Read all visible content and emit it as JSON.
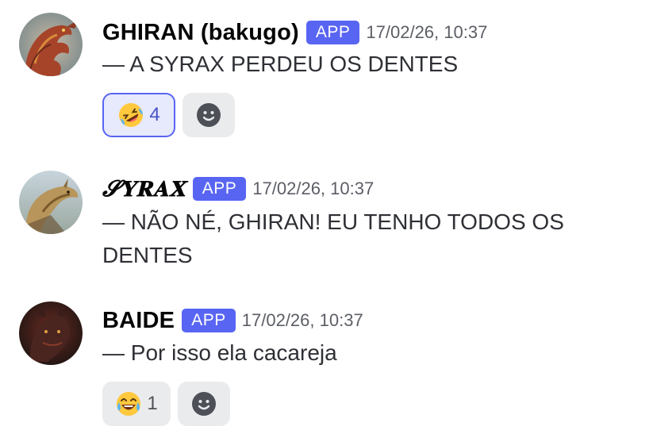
{
  "messages": [
    {
      "username": "GHIRAN (bakugo)",
      "badge": "APP",
      "timestamp": "17/02/26, 10:37",
      "content": "— A SYRAX PERDEU OS DENTES",
      "avatar_icon": "red-dragon-avatar",
      "reactions": [
        {
          "emoji": "rolling-on-floor-laughing",
          "count": "4",
          "active": true
        }
      ]
    },
    {
      "username": "𝓢𝐘𝐑𝐀𝐗",
      "badge": "APP",
      "timestamp": "17/02/26, 10:37",
      "content": "— NÃO NÉ, GHIRAN! EU TENHO TODOS OS DENTES",
      "avatar_icon": "golden-dragon-avatar",
      "reactions": []
    },
    {
      "username": "BAIDE",
      "badge": "APP",
      "timestamp": "17/02/26, 10:37",
      "content": "— Por isso ela cacareja",
      "avatar_icon": "dark-dragon-avatar",
      "reactions": [
        {
          "emoji": "face-with-tears-of-joy",
          "count": "1",
          "active": false
        }
      ]
    }
  ],
  "colors": {
    "badge": "#5865f2",
    "reaction_active_bg": "#e7e9fd",
    "reaction_bg": "#eaebed",
    "username": "#060607",
    "timestamp": "#5c5e66"
  }
}
